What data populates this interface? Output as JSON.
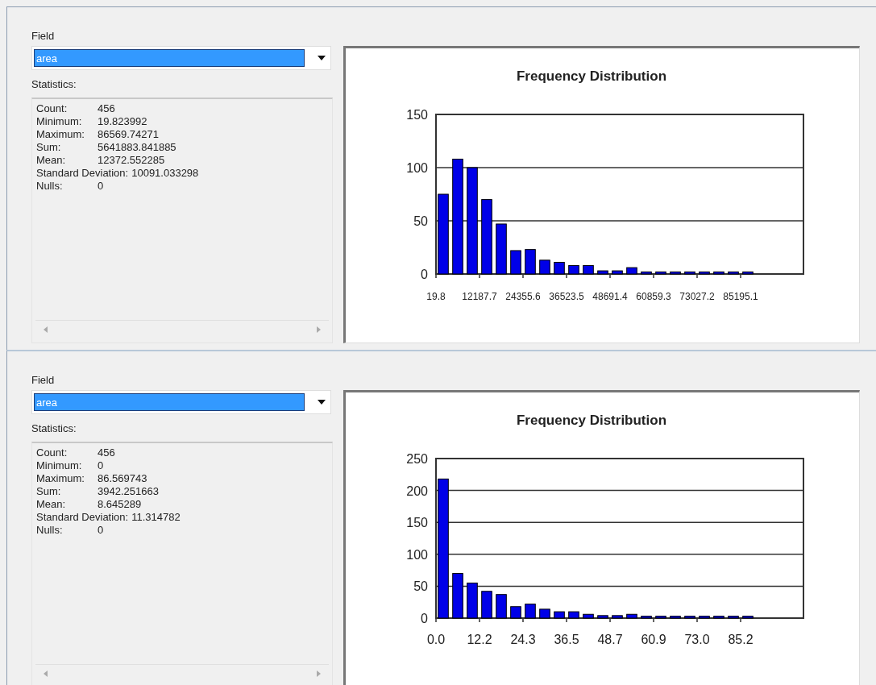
{
  "panels": [
    {
      "field_label": "Field",
      "field_value": "area",
      "field_selected": true,
      "statistics_label": "Statistics:",
      "stats": [
        {
          "kind": "aligned",
          "label": "Count:",
          "value": "456"
        },
        {
          "kind": "aligned",
          "label": "Minimum:",
          "value": "19.823992"
        },
        {
          "kind": "aligned",
          "label": "Maximum:",
          "value": "86569.74271"
        },
        {
          "kind": "aligned",
          "label": "Sum:",
          "value": "5641883.841885"
        },
        {
          "kind": "aligned",
          "label": "Mean:",
          "value": "12372.552285"
        },
        {
          "kind": "inline",
          "label": "Standard Deviation:",
          "value": "10091.033298"
        },
        {
          "kind": "aligned",
          "label": "Nulls:",
          "value": "0"
        }
      ],
      "chart_data": {
        "type": "bar",
        "title": "Frequency Distribution",
        "grid": true,
        "x": [
          2047.8,
          6103.8,
          10159.7,
          14215.7,
          18271.7,
          22327.6,
          26383.6,
          30439.6,
          34495.5,
          38551.5,
          42607.5,
          46663.4,
          50719.4,
          54775.4,
          58831.3,
          62887.3,
          66943.3,
          70999.2,
          75055.2,
          79111.2,
          83167.1,
          87223.1
        ],
        "values": [
          75,
          108,
          100,
          70,
          47,
          22,
          23,
          13,
          11,
          8,
          8,
          3,
          3,
          6,
          2,
          2,
          2,
          2,
          2,
          2,
          2,
          2
        ],
        "xlim": [
          19.8,
          102771.0
        ],
        "ylim": [
          0,
          150
        ],
        "yticks": [
          0,
          50,
          100,
          150
        ],
        "xticks": [
          {
            "value": 19.8,
            "label": "19.8"
          },
          {
            "value": 12187.7,
            "label": "12187.7"
          },
          {
            "value": 24355.6,
            "label": "24355.6"
          },
          {
            "value": 36523.5,
            "label": "36523.5"
          },
          {
            "value": 48691.4,
            "label": "48691.4"
          },
          {
            "value": 60859.3,
            "label": "60859.3"
          },
          {
            "value": 73027.2,
            "label": "73027.2"
          },
          {
            "value": 85195.1,
            "label": "85195.1"
          }
        ]
      }
    },
    {
      "field_label": "Field",
      "field_value": "area",
      "field_selected": true,
      "statistics_label": "Statistics:",
      "stats": [
        {
          "kind": "aligned",
          "label": "Count:",
          "value": "456"
        },
        {
          "kind": "aligned",
          "label": "Minimum:",
          "value": "0"
        },
        {
          "kind": "aligned",
          "label": "Maximum:",
          "value": "86.569743"
        },
        {
          "kind": "aligned",
          "label": "Sum:",
          "value": "3942.251663"
        },
        {
          "kind": "aligned",
          "label": "Mean:",
          "value": "8.645289"
        },
        {
          "kind": "inline",
          "label": "Standard Deviation:",
          "value": "11.314782"
        },
        {
          "kind": "aligned",
          "label": "Nulls:",
          "value": "0"
        }
      ],
      "chart_data": {
        "type": "bar",
        "title": "Frequency Distribution",
        "grid": true,
        "x": [
          2.03,
          6.09,
          10.14,
          14.2,
          18.26,
          22.31,
          26.37,
          30.43,
          34.49,
          38.54,
          42.6,
          46.66,
          50.71,
          54.77,
          58.83,
          62.89,
          66.94,
          71.0,
          75.06,
          79.11,
          83.17,
          87.23
        ],
        "values": [
          218,
          70,
          55,
          42,
          37,
          18,
          22,
          14,
          10,
          10,
          6,
          4,
          4,
          6,
          3,
          3,
          3,
          3,
          3,
          3,
          3,
          3
        ],
        "xlim": [
          0.0,
          102.78
        ],
        "ylim": [
          0,
          250
        ],
        "yticks": [
          0,
          50,
          100,
          150,
          200,
          250
        ],
        "xticks": [
          {
            "value": 0.0,
            "label": "0.0"
          },
          {
            "value": 12.17,
            "label": "12.2"
          },
          {
            "value": 24.34,
            "label": "24.3"
          },
          {
            "value": 36.51,
            "label": "36.5"
          },
          {
            "value": 48.69,
            "label": "48.7"
          },
          {
            "value": 60.86,
            "label": "60.9"
          },
          {
            "value": 73.03,
            "label": "73.0"
          },
          {
            "value": 85.2,
            "label": "85.2"
          }
        ]
      }
    }
  ]
}
